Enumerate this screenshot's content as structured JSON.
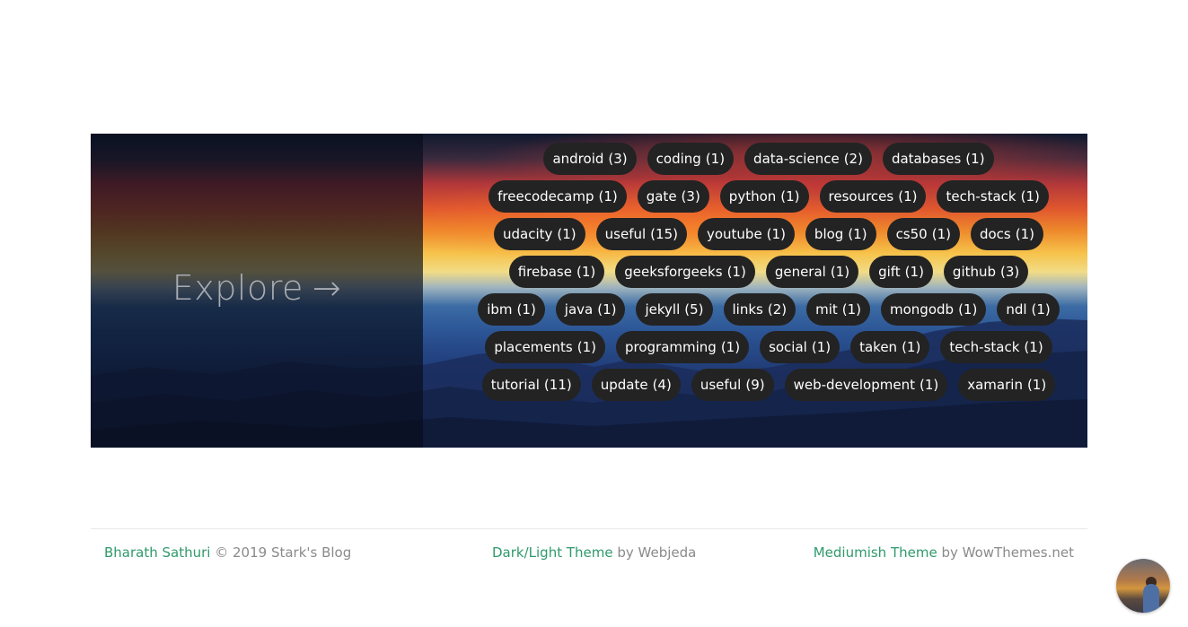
{
  "explore": {
    "label": "Explore",
    "arrow": "→"
  },
  "tags": [
    {
      "name": "android",
      "count": "(3)"
    },
    {
      "name": "coding",
      "count": "(1)"
    },
    {
      "name": "data-science",
      "count": "(2)"
    },
    {
      "name": "databases",
      "count": "(1)"
    },
    {
      "name": "freecodecamp",
      "count": "(1)"
    },
    {
      "name": "gate",
      "count": "(3)"
    },
    {
      "name": "python",
      "count": "(1)"
    },
    {
      "name": "resources",
      "count": "(1)"
    },
    {
      "name": "tech-stack",
      "count": "(1)"
    },
    {
      "name": "udacity",
      "count": "(1)"
    },
    {
      "name": "useful",
      "count": "(15)"
    },
    {
      "name": "youtube",
      "count": "(1)"
    },
    {
      "name": "blog",
      "count": "(1)"
    },
    {
      "name": "cs50",
      "count": "(1)"
    },
    {
      "name": "docs",
      "count": "(1)"
    },
    {
      "name": "firebase",
      "count": "(1)"
    },
    {
      "name": "geeksforgeeks",
      "count": "(1)"
    },
    {
      "name": "general",
      "count": "(1)"
    },
    {
      "name": "gift",
      "count": "(1)"
    },
    {
      "name": "github",
      "count": "(3)"
    },
    {
      "name": "ibm",
      "count": "(1)"
    },
    {
      "name": "java",
      "count": "(1)"
    },
    {
      "name": "jekyll",
      "count": "(5)"
    },
    {
      "name": "links",
      "count": "(2)"
    },
    {
      "name": "mit",
      "count": "(1)"
    },
    {
      "name": "mongodb",
      "count": "(1)"
    },
    {
      "name": "ndl",
      "count": "(1)"
    },
    {
      "name": "placements",
      "count": "(1)"
    },
    {
      "name": "programming",
      "count": "(1)"
    },
    {
      "name": "social",
      "count": "(1)"
    },
    {
      "name": "taken",
      "count": "(1)"
    },
    {
      "name": "tech-stack",
      "count": "(1)"
    },
    {
      "name": "tutorial",
      "count": "(11)"
    },
    {
      "name": "update",
      "count": "(4)"
    },
    {
      "name": "useful",
      "count": "(9)"
    },
    {
      "name": "web-development",
      "count": "(1)"
    },
    {
      "name": "xamarin",
      "count": "(1)"
    }
  ],
  "footer": {
    "author_link": "Bharath Sathuri",
    "copyright": "© 2019 Stark's Blog",
    "theme_link": "Dark/Light Theme",
    "theme_by": "by Webjeda",
    "mediumish_link": "Mediumish Theme",
    "mediumish_by": "by WowThemes.net"
  },
  "colors": {
    "link": "#2f9a6b",
    "tag_bg": "#232323",
    "footer_text": "#8a8a8a"
  }
}
